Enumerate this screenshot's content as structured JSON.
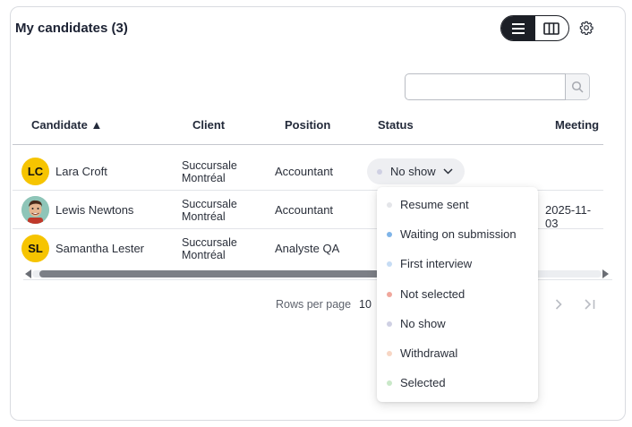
{
  "header": {
    "title": "My candidates (3)"
  },
  "search": {
    "placeholder": "",
    "value": ""
  },
  "columns": {
    "candidate": "Candidate ▲",
    "client": "Client",
    "position": "Position",
    "status": "Status",
    "meeting": "Meeting"
  },
  "rows": [
    {
      "initials": "LC",
      "name": "Lara Croft",
      "client_line1": "Succursale",
      "client_line2": "Montréal",
      "position": "Accountant",
      "status": "No show",
      "meeting": ""
    },
    {
      "initials": "",
      "name": "Lewis Newtons",
      "client_line1": "Succursale",
      "client_line2": "Montréal",
      "position": "Accountant",
      "status": "",
      "meeting": "2025-11-03"
    },
    {
      "initials": "SL",
      "name": "Samantha Lester",
      "client_line1": "Succursale",
      "client_line2": "Montréal",
      "position": "Analyste QA",
      "status": "",
      "meeting": ""
    }
  ],
  "pagination": {
    "rows_per_page_label": "Rows per page",
    "rows_per_page_value": "10"
  },
  "status_menu": {
    "items": [
      {
        "label": "Resume sent",
        "color": "#e4e5e9"
      },
      {
        "label": "Waiting on submission",
        "color": "#7fb4e8"
      },
      {
        "label": "First interview",
        "color": "#c6dcf4"
      },
      {
        "label": "Not selected",
        "color": "#f0a79c"
      },
      {
        "label": "No show",
        "color": "#cfd0e3"
      },
      {
        "label": "Withdrawal",
        "color": "#f7d6c4"
      },
      {
        "label": "Selected",
        "color": "#c9e8c8"
      }
    ]
  },
  "colors": {
    "avatar_yellow": "#f6c400",
    "toggle_dark": "#1c1f26"
  },
  "icons": {
    "list_view": "list-view-icon",
    "column_view": "columns-view-icon",
    "settings": "gear-icon",
    "search": "search-icon",
    "next_page": "chevron-right-icon",
    "last_page": "last-page-icon"
  }
}
